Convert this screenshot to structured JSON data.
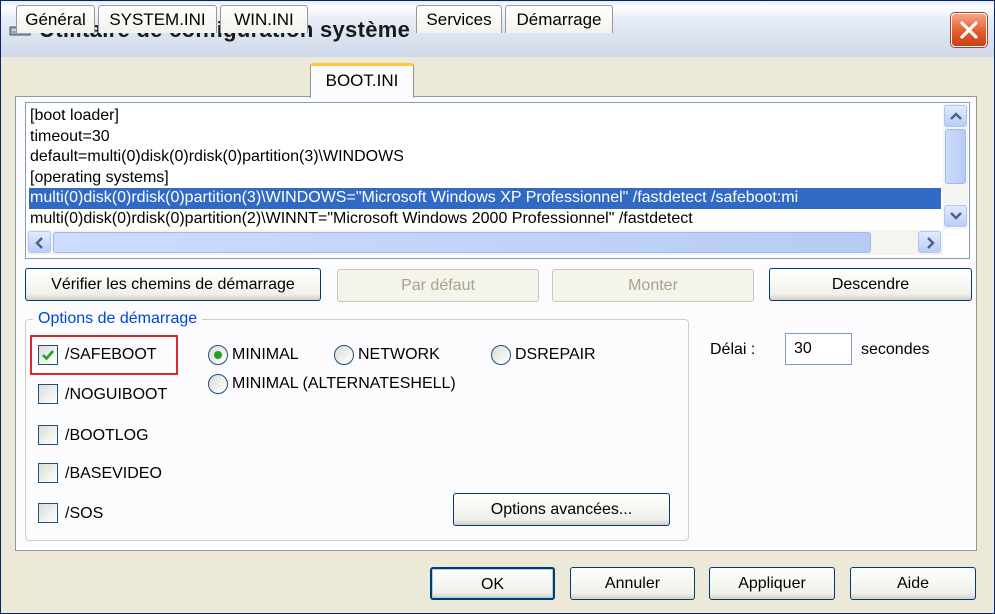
{
  "window": {
    "title": "Utilitaire de configuration système",
    "app_icon": "settings-app-icon",
    "close_icon": "close-icon"
  },
  "tabs": [
    {
      "label": "Général",
      "active": false
    },
    {
      "label": "SYSTEM.INI",
      "active": false
    },
    {
      "label": "WIN.INI",
      "active": false
    },
    {
      "label": "BOOT.INI",
      "active": true
    },
    {
      "label": "Services",
      "active": false
    },
    {
      "label": "Démarrage",
      "active": false
    }
  ],
  "bootini": {
    "lines": [
      "[boot loader]",
      "timeout=30",
      "default=multi(0)disk(0)rdisk(0)partition(3)\\WINDOWS",
      "[operating systems]",
      "multi(0)disk(0)rdisk(0)partition(3)\\WINDOWS=\"Microsoft Windows XP Professionnel\" /fastdetect /safeboot:mi",
      "multi(0)disk(0)rdisk(0)partition(2)\\WINNT=\"Microsoft Windows 2000 Professionnel\" /fastdetect"
    ],
    "selected_index": 4
  },
  "buttons": {
    "verify_paths": "Vérifier les chemins de démarrage",
    "default": "Par défaut",
    "move_up": "Monter",
    "move_down": "Descendre",
    "advanced": "Options avancées...",
    "ok": "OK",
    "cancel": "Annuler",
    "apply": "Appliquer",
    "help": "Aide"
  },
  "boot_options": {
    "group_label": "Options de démarrage",
    "checkboxes": [
      {
        "label": "/SAFEBOOT",
        "checked": true
      },
      {
        "label": "/NOGUIBOOT",
        "checked": false
      },
      {
        "label": "/BOOTLOG",
        "checked": false
      },
      {
        "label": "/BASEVIDEO",
        "checked": false
      },
      {
        "label": "/SOS",
        "checked": false
      }
    ],
    "radios": [
      {
        "label": "MINIMAL",
        "selected": true
      },
      {
        "label": "NETWORK",
        "selected": false
      },
      {
        "label": "DSREPAIR",
        "selected": false
      },
      {
        "label": "MINIMAL (ALTERNATESHELL)",
        "selected": false
      }
    ]
  },
  "timeout": {
    "label": "Délai :",
    "value": "30",
    "unit": "secondes"
  },
  "colors": {
    "selection": "#316ac5",
    "highlight_border": "#d92b2b",
    "active_tab_accent": "#ffc83c",
    "group_label": "#0046d5"
  }
}
